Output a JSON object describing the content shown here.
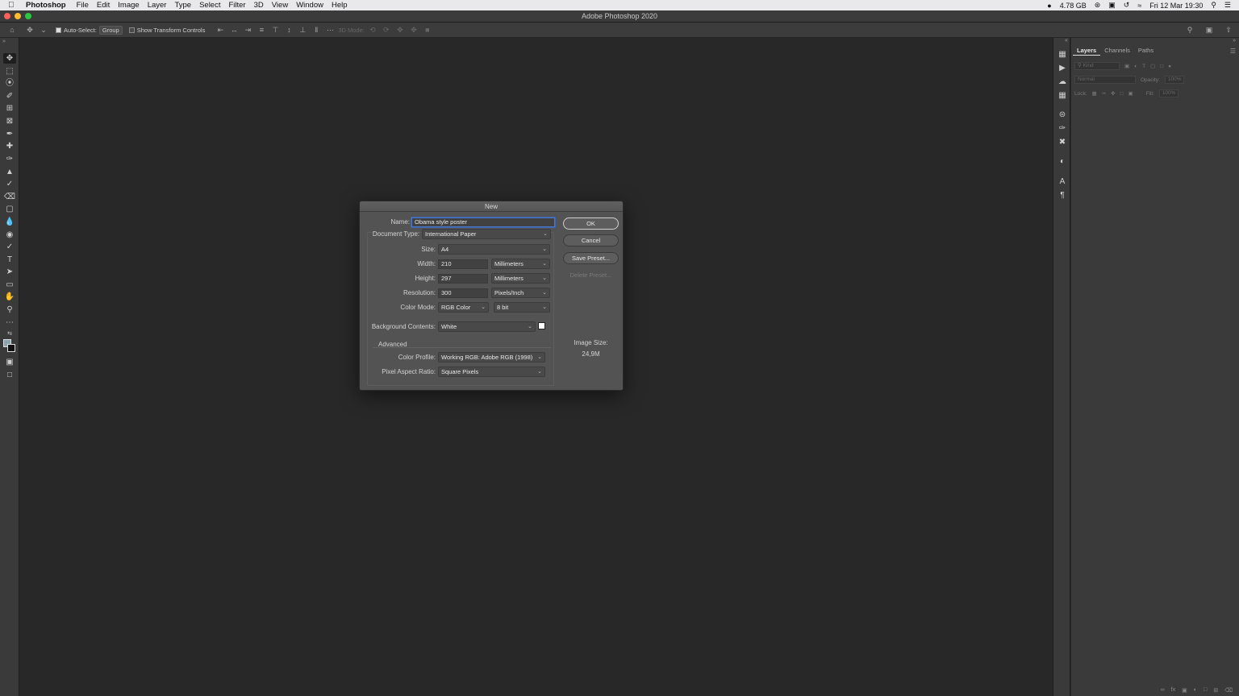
{
  "menubar": {
    "app_name": "Photoshop",
    "items": [
      "File",
      "Edit",
      "Image",
      "Layer",
      "Type",
      "Select",
      "Filter",
      "3D",
      "View",
      "Window",
      "Help"
    ],
    "memory": "4.78 GB",
    "datetime": "Fri 12 Mar 19:30"
  },
  "window": {
    "title": "Adobe Photoshop 2020"
  },
  "options_bar": {
    "auto_select_label": "Auto-Select:",
    "auto_select_checked": true,
    "auto_select_target": "Group",
    "show_transform_label": "Show Transform Controls",
    "show_transform_checked": false,
    "mode_3d_label": "3D Mode:"
  },
  "layers_panel": {
    "tabs": [
      "Layers",
      "Channels",
      "Paths"
    ],
    "active_tab": "Layers",
    "kind_placeholder": "Kind",
    "blend_mode": "Normal",
    "opacity_label": "Opacity:",
    "opacity_value": "100%",
    "lock_label": "Lock:",
    "fill_label": "Fill:",
    "fill_value": "100%"
  },
  "dialog": {
    "title": "New",
    "name_label": "Name:",
    "name_value": "Obama style poster",
    "doc_type_label": "Document Type:",
    "doc_type_value": "International Paper",
    "size_label": "Size:",
    "size_value": "A4",
    "width_label": "Width:",
    "width_value": "210",
    "width_unit": "Millimeters",
    "height_label": "Height:",
    "height_value": "297",
    "height_unit": "Millimeters",
    "resolution_label": "Resolution:",
    "resolution_value": "300",
    "resolution_unit": "Pixels/Inch",
    "color_mode_label": "Color Mode:",
    "color_mode_value": "RGB Color",
    "bit_depth": "8 bit",
    "bg_contents_label": "Background Contents:",
    "bg_contents_value": "White",
    "advanced_label": "Advanced",
    "color_profile_label": "Color Profile:",
    "color_profile_value": "Working RGB:  Adobe RGB (1998)",
    "pixel_aspect_label": "Pixel Aspect Ratio:",
    "pixel_aspect_value": "Square Pixels",
    "image_size_label": "Image Size:",
    "image_size_value": "24,9M",
    "buttons": {
      "ok": "OK",
      "cancel": "Cancel",
      "save_preset": "Save Preset...",
      "delete_preset": "Delete Preset..."
    }
  },
  "colors": {
    "foreground": "#8aa4b0",
    "background": "#111111",
    "bg_swatch": "#ffffff",
    "focus": "#4b77c9"
  }
}
